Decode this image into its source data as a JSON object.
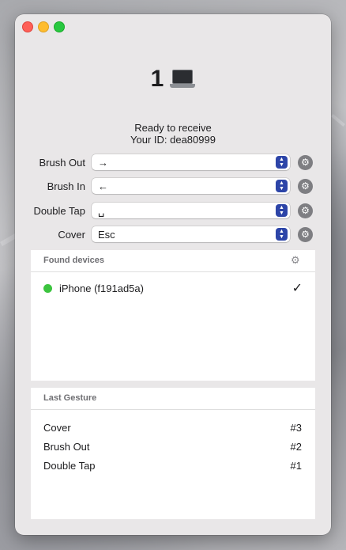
{
  "app": {
    "device_count": "1",
    "status_line": "Ready to receive",
    "id_line": "Your ID: dea80999"
  },
  "mappings": [
    {
      "label": "Brush Out",
      "value": "→"
    },
    {
      "label": "Brush In",
      "value": "←"
    },
    {
      "label": "Double Tap",
      "value": "␣"
    },
    {
      "label": "Cover",
      "value": "Esc"
    }
  ],
  "found_devices": {
    "title": "Found devices",
    "items": [
      {
        "name": "iPhone (f191ad5a)",
        "status_color": "#3cc43f",
        "selected": true
      }
    ]
  },
  "last_gesture": {
    "title": "Last Gesture",
    "items": [
      {
        "name": "Cover",
        "index": "#3"
      },
      {
        "name": "Brush Out",
        "index": "#2"
      },
      {
        "name": "Double Tap",
        "index": "#1"
      }
    ]
  },
  "icons": {
    "hero": "laptop-icon",
    "row_action": "gear-icon",
    "stepper": "chevron-updown-icon",
    "selected": "checkmark-icon"
  },
  "colors": {
    "accent": "#2d45a8",
    "online": "#3cc43f",
    "close": "#fe5f57",
    "minimize": "#febc2e",
    "zoom": "#28c840"
  }
}
